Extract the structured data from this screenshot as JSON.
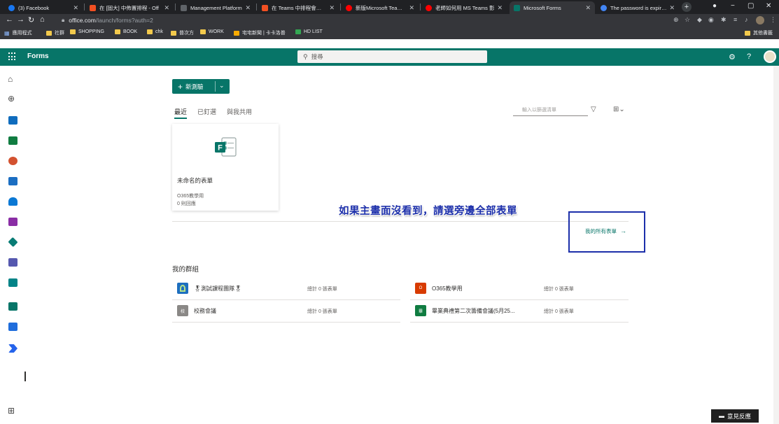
{
  "browser": {
    "tabs": [
      {
        "title": "(3) Facebook",
        "favicon_color": "#1877f2"
      },
      {
        "title": "在 [固大] 中佈置排程 - Off",
        "favicon_color": "#f25022"
      },
      {
        "title": "Management Platform",
        "favicon_color": "#5f6368"
      },
      {
        "title": "在 Teams 中排程會議 - Of",
        "favicon_color": "#f25022"
      },
      {
        "title": "新版Microsoft Teams-退|",
        "favicon_color": "#ff0000"
      },
      {
        "title": "老師如何用 MS Teams 影",
        "favicon_color": "#ff0000"
      },
      {
        "title": "Microsoft Forms",
        "favicon_color": "#077568"
      },
      {
        "title": "The password is expired",
        "favicon_color": "#4285f4"
      }
    ],
    "url_domain": "office.com",
    "url_path": "/launch/forms?auth=2",
    "bookmarks": [
      "應用程式",
      "社群",
      "SHOPPING",
      "BOOK",
      "chk",
      "普次方",
      "WORK",
      "宅宅新聞 | 卡卡洛普",
      "HD LIST"
    ],
    "other_bookmarks": "其他書籤"
  },
  "header": {
    "app_name": "Forms",
    "search_placeholder": "搜尋"
  },
  "main": {
    "new_button_label": "新測驗",
    "tabs": [
      "最近",
      "已釘選",
      "與我共用"
    ],
    "filter_placeholder": "輸入以篩選清單",
    "recent_forms": [
      {
        "title": "未命名的表單",
        "group": "O365教學用",
        "responses": "0 則回應"
      }
    ],
    "annotation_text": "如果主畫面沒看到，請選旁邊全部表單",
    "all_forms_label": "我的所有表單",
    "groups_title": "我的群組",
    "groups": [
      {
        "name": "🎖測試課程團隊🎖",
        "count": "總計 0 張表單",
        "icon_color": "#1e6fbf",
        "icon_text": ""
      },
      {
        "name": "O365教學用",
        "count": "總計 0 張表單",
        "icon_color": "#d83b01",
        "icon_text": "O"
      },
      {
        "name": "校務會議",
        "count": "總計 0 張表單",
        "icon_color": "#8a8886",
        "icon_text": "校"
      },
      {
        "name": "畢業典禮第二次籌備會議(5月25...",
        "count": "總計 0 張表單",
        "icon_color": "#107c41",
        "icon_text": "畢"
      }
    ]
  },
  "feedback_label": "意見反應",
  "colors": {
    "brand": "#077568",
    "annotation": "#1c2faa"
  }
}
